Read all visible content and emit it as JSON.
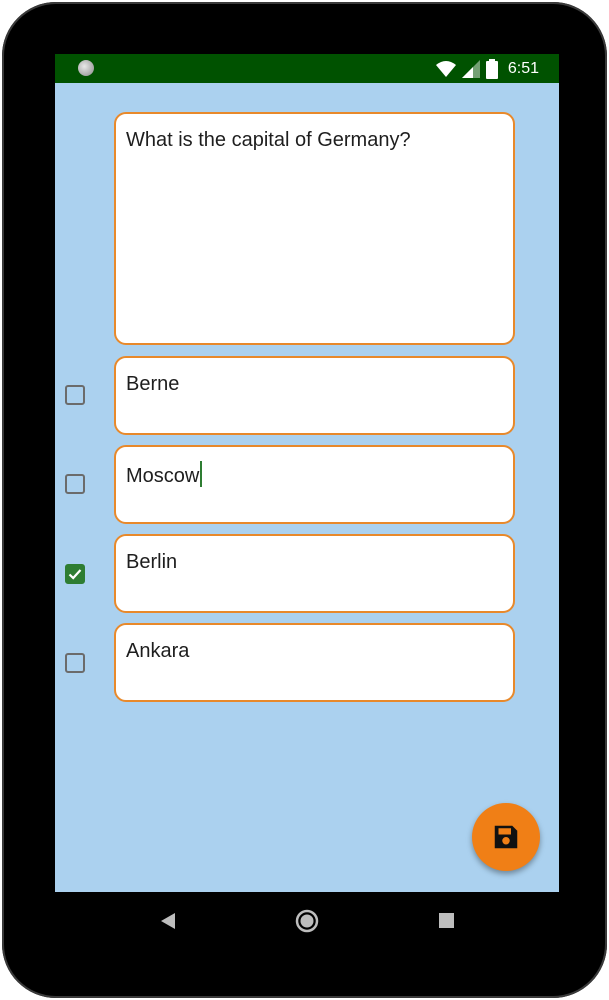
{
  "status_bar": {
    "time": "6:51",
    "icons": [
      "notification-dot-icon",
      "wifi-icon",
      "cell-signal-icon",
      "battery-icon"
    ]
  },
  "question": {
    "text": "What is the capital of Germany?"
  },
  "answers": [
    {
      "text": "Berne",
      "checked": false
    },
    {
      "text": "Moscow",
      "checked": false
    },
    {
      "text": "Berlin",
      "checked": true
    },
    {
      "text": "Ankara",
      "checked": false
    }
  ],
  "fab": {
    "icon": "save-icon"
  },
  "nav": {
    "icons": [
      "back-icon",
      "home-icon",
      "recents-icon"
    ]
  },
  "colors": {
    "status_bar": "#005200",
    "background": "#abd1ef",
    "field_border": "#e8892b",
    "checkbox_checked": "#2e7d32",
    "fab": "#f07f16"
  }
}
